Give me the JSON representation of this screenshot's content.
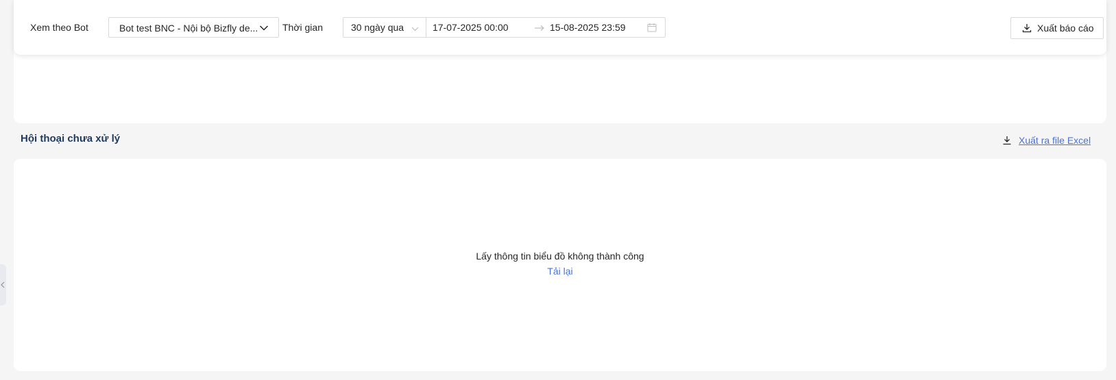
{
  "filters": {
    "bot_label": "Xem theo Bot",
    "bot_value": "Bot test BNC - Nội bộ Bizfly de...",
    "time_label": "Thời gian",
    "period_value": "30 ngày qua",
    "start_date": "17-07-2025 00:00",
    "end_date": "15-08-2025 23:59",
    "export_report_label": "Xuất báo cáo"
  },
  "section": {
    "title": "Hội thoại chưa xử lý",
    "export_excel_label": "Xuất ra file Excel"
  },
  "chart": {
    "error_message": "Lấy thông tin biểu đồ không thành công",
    "reload_label": "Tải lại"
  },
  "icons": {
    "chevron": "chevron-down-icon",
    "calendar": "calendar-icon",
    "download": "download-icon",
    "arrow": "arrow-right-icon",
    "collapse": "chevron-left-icon"
  },
  "colors": {
    "link": "#4a72d8",
    "title": "#1f3a5f",
    "background": "#f5f5f5"
  }
}
